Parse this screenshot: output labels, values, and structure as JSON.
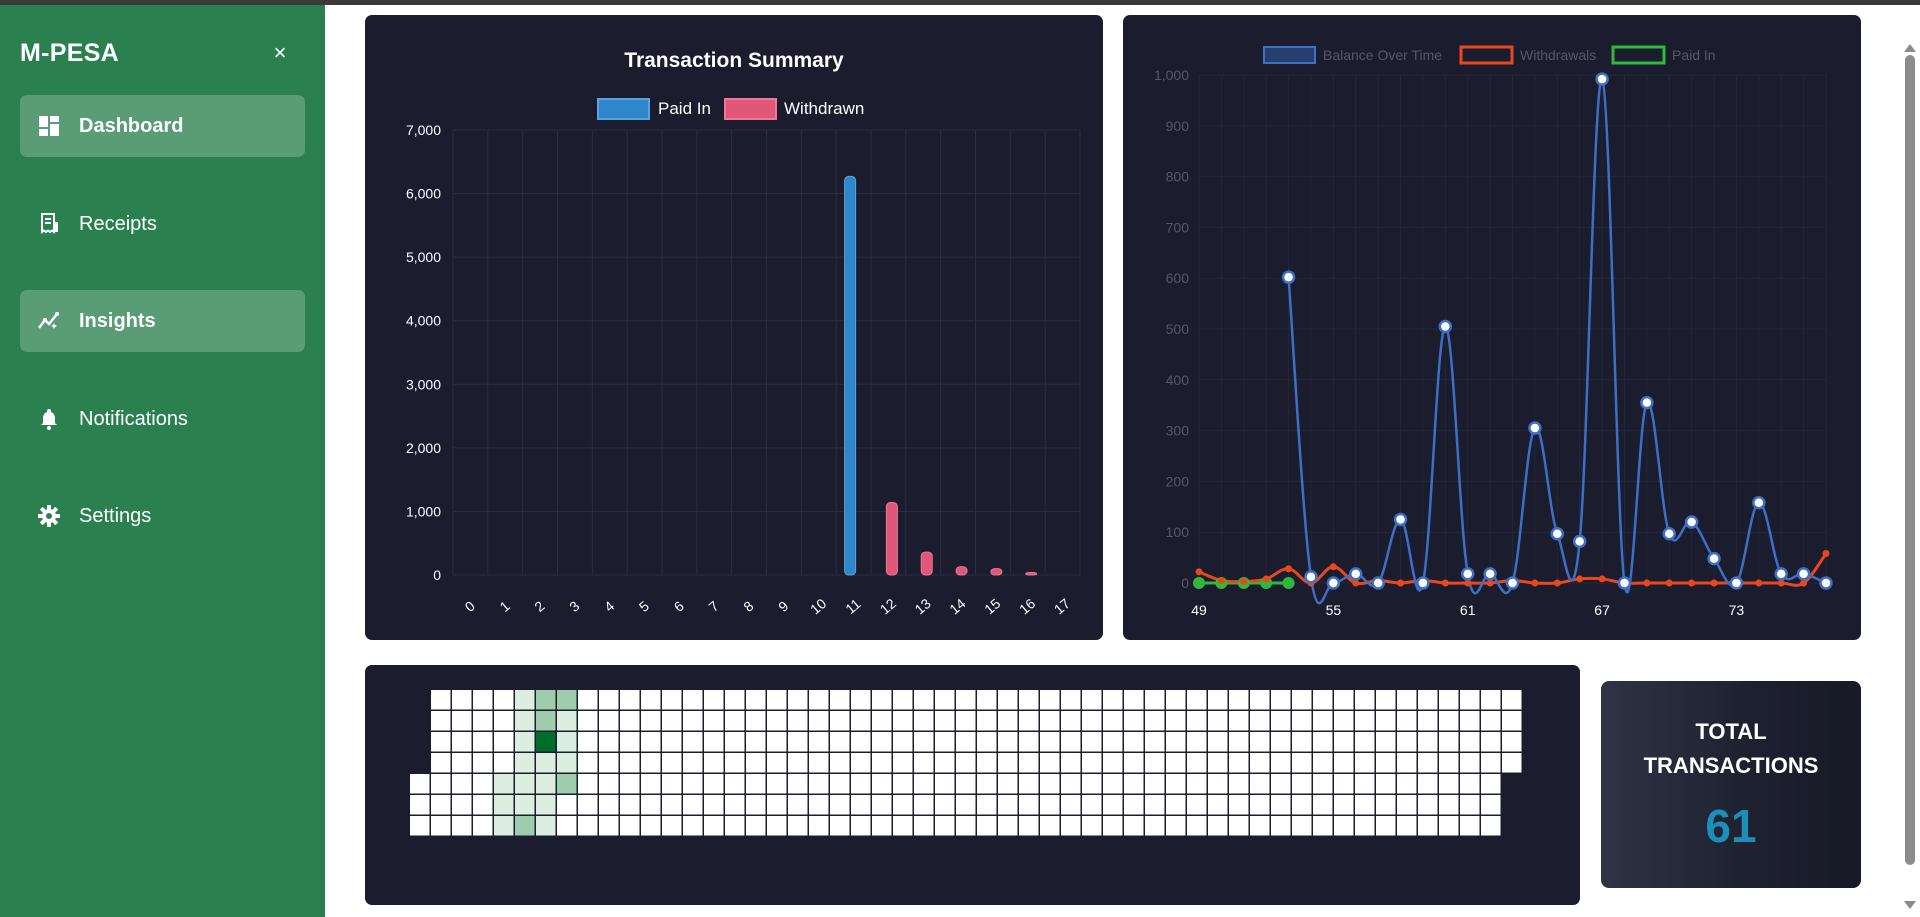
{
  "app": {
    "brand": "M-PESA",
    "close_label": "×"
  },
  "sidebar": {
    "items": [
      {
        "label": "Dashboard",
        "icon": "dashboard-icon",
        "active": true
      },
      {
        "label": "Receipts",
        "icon": "receipt-icon",
        "active": false
      },
      {
        "label": "Insights",
        "icon": "insights-icon",
        "active": true
      },
      {
        "label": "Notifications",
        "icon": "bell-icon",
        "active": false
      },
      {
        "label": "Settings",
        "icon": "gear-icon",
        "active": false
      }
    ]
  },
  "colors": {
    "sidebar": "#2b8050",
    "panel": "#1b1c2e",
    "paid_in_bar": "#2f86c8",
    "withdrawn_bar": "#e0577a",
    "balance_line": "#3d6fc4",
    "withdrawals_line": "#e8481e",
    "paid_in_line": "#2fb83a",
    "stat_value": "#1b8fb8"
  },
  "stat_card": {
    "title": "TOTAL TRANSACTIONS",
    "value": "61"
  },
  "chart_data": [
    {
      "type": "bar",
      "title": "Transaction Summary",
      "categories": [
        "0",
        "1",
        "2",
        "3",
        "4",
        "5",
        "6",
        "7",
        "8",
        "9",
        "10",
        "11",
        "12",
        "13",
        "14",
        "15",
        "16",
        "17"
      ],
      "series": [
        {
          "name": "Paid In",
          "values": [
            0,
            0,
            0,
            0,
            0,
            0,
            0,
            0,
            0,
            0,
            0,
            6270,
            0,
            0,
            0,
            0,
            0,
            0
          ]
        },
        {
          "name": "Withdrawn",
          "values": [
            0,
            0,
            0,
            0,
            0,
            0,
            0,
            0,
            0,
            0,
            0,
            0,
            1140,
            360,
            130,
            100,
            40,
            0
          ]
        }
      ],
      "yticks": [
        "0",
        "1,000",
        "2,000",
        "3,000",
        "4,000",
        "5,000",
        "6,000",
        "7,000"
      ],
      "ylim": [
        0,
        7000
      ],
      "grid": true,
      "legend": "top"
    },
    {
      "type": "line",
      "title": "",
      "xlim": [
        49,
        77
      ],
      "xticks": [
        "49",
        "55",
        "61",
        "67",
        "73"
      ],
      "yticks": [
        "0",
        "100",
        "200",
        "300",
        "400",
        "500",
        "600",
        "700",
        "800",
        "900",
        "1,000"
      ],
      "ylim": [
        0,
        1000
      ],
      "grid": true,
      "legend": "top",
      "series": [
        {
          "name": "Balance Over Time",
          "x": [
            53,
            54,
            55,
            56,
            57,
            58,
            59,
            60,
            61,
            62,
            63,
            64,
            65,
            66,
            67,
            68,
            69,
            70,
            71,
            72,
            73,
            74,
            75,
            76,
            77
          ],
          "values": [
            602,
            12,
            0,
            18,
            0,
            125,
            0,
            505,
            18,
            18,
            0,
            305,
            97,
            82,
            992,
            0,
            355,
            97,
            120,
            48,
            0,
            158,
            18,
            18,
            0
          ]
        },
        {
          "name": "Withdrawals",
          "x": [
            49,
            50,
            51,
            52,
            53,
            54,
            55,
            56,
            57,
            58,
            59,
            60,
            61,
            62,
            63,
            64,
            65,
            66,
            67,
            68,
            69,
            70,
            71,
            72,
            73,
            74,
            75,
            76,
            77
          ],
          "values": [
            22,
            5,
            3,
            8,
            28,
            0,
            32,
            0,
            5,
            0,
            5,
            0,
            0,
            0,
            5,
            0,
            0,
            8,
            8,
            0,
            0,
            0,
            0,
            0,
            0,
            0,
            0,
            0,
            58
          ]
        },
        {
          "name": "Paid In",
          "x": [
            49,
            50,
            51,
            52,
            53
          ],
          "values": [
            0,
            0,
            0,
            0,
            0
          ]
        }
      ]
    },
    {
      "type": "heatmap",
      "title": "",
      "columns": 53,
      "rows": 7,
      "cells": [
        {
          "col": 5,
          "row": 0,
          "level": 1
        },
        {
          "col": 6,
          "row": 0,
          "level": 2
        },
        {
          "col": 7,
          "row": 0,
          "level": 2
        },
        {
          "col": 5,
          "row": 1,
          "level": 1
        },
        {
          "col": 6,
          "row": 1,
          "level": 2
        },
        {
          "col": 7,
          "row": 1,
          "level": 1
        },
        {
          "col": 5,
          "row": 2,
          "level": 1
        },
        {
          "col": 6,
          "row": 2,
          "level": 4
        },
        {
          "col": 7,
          "row": 2,
          "level": 1
        },
        {
          "col": 5,
          "row": 3,
          "level": 1
        },
        {
          "col": 6,
          "row": 3,
          "level": 1
        },
        {
          "col": 7,
          "row": 3,
          "level": 1
        },
        {
          "col": 4,
          "row": 4,
          "level": 1
        },
        {
          "col": 5,
          "row": 4,
          "level": 1
        },
        {
          "col": 6,
          "row": 4,
          "level": 1
        },
        {
          "col": 7,
          "row": 4,
          "level": 2
        },
        {
          "col": 4,
          "row": 5,
          "level": 1
        },
        {
          "col": 5,
          "row": 5,
          "level": 1
        },
        {
          "col": 6,
          "row": 5,
          "level": 1
        },
        {
          "col": 4,
          "row": 6,
          "level": 1
        },
        {
          "col": 5,
          "row": 6,
          "level": 2
        },
        {
          "col": 6,
          "row": 6,
          "level": 1
        }
      ]
    }
  ]
}
